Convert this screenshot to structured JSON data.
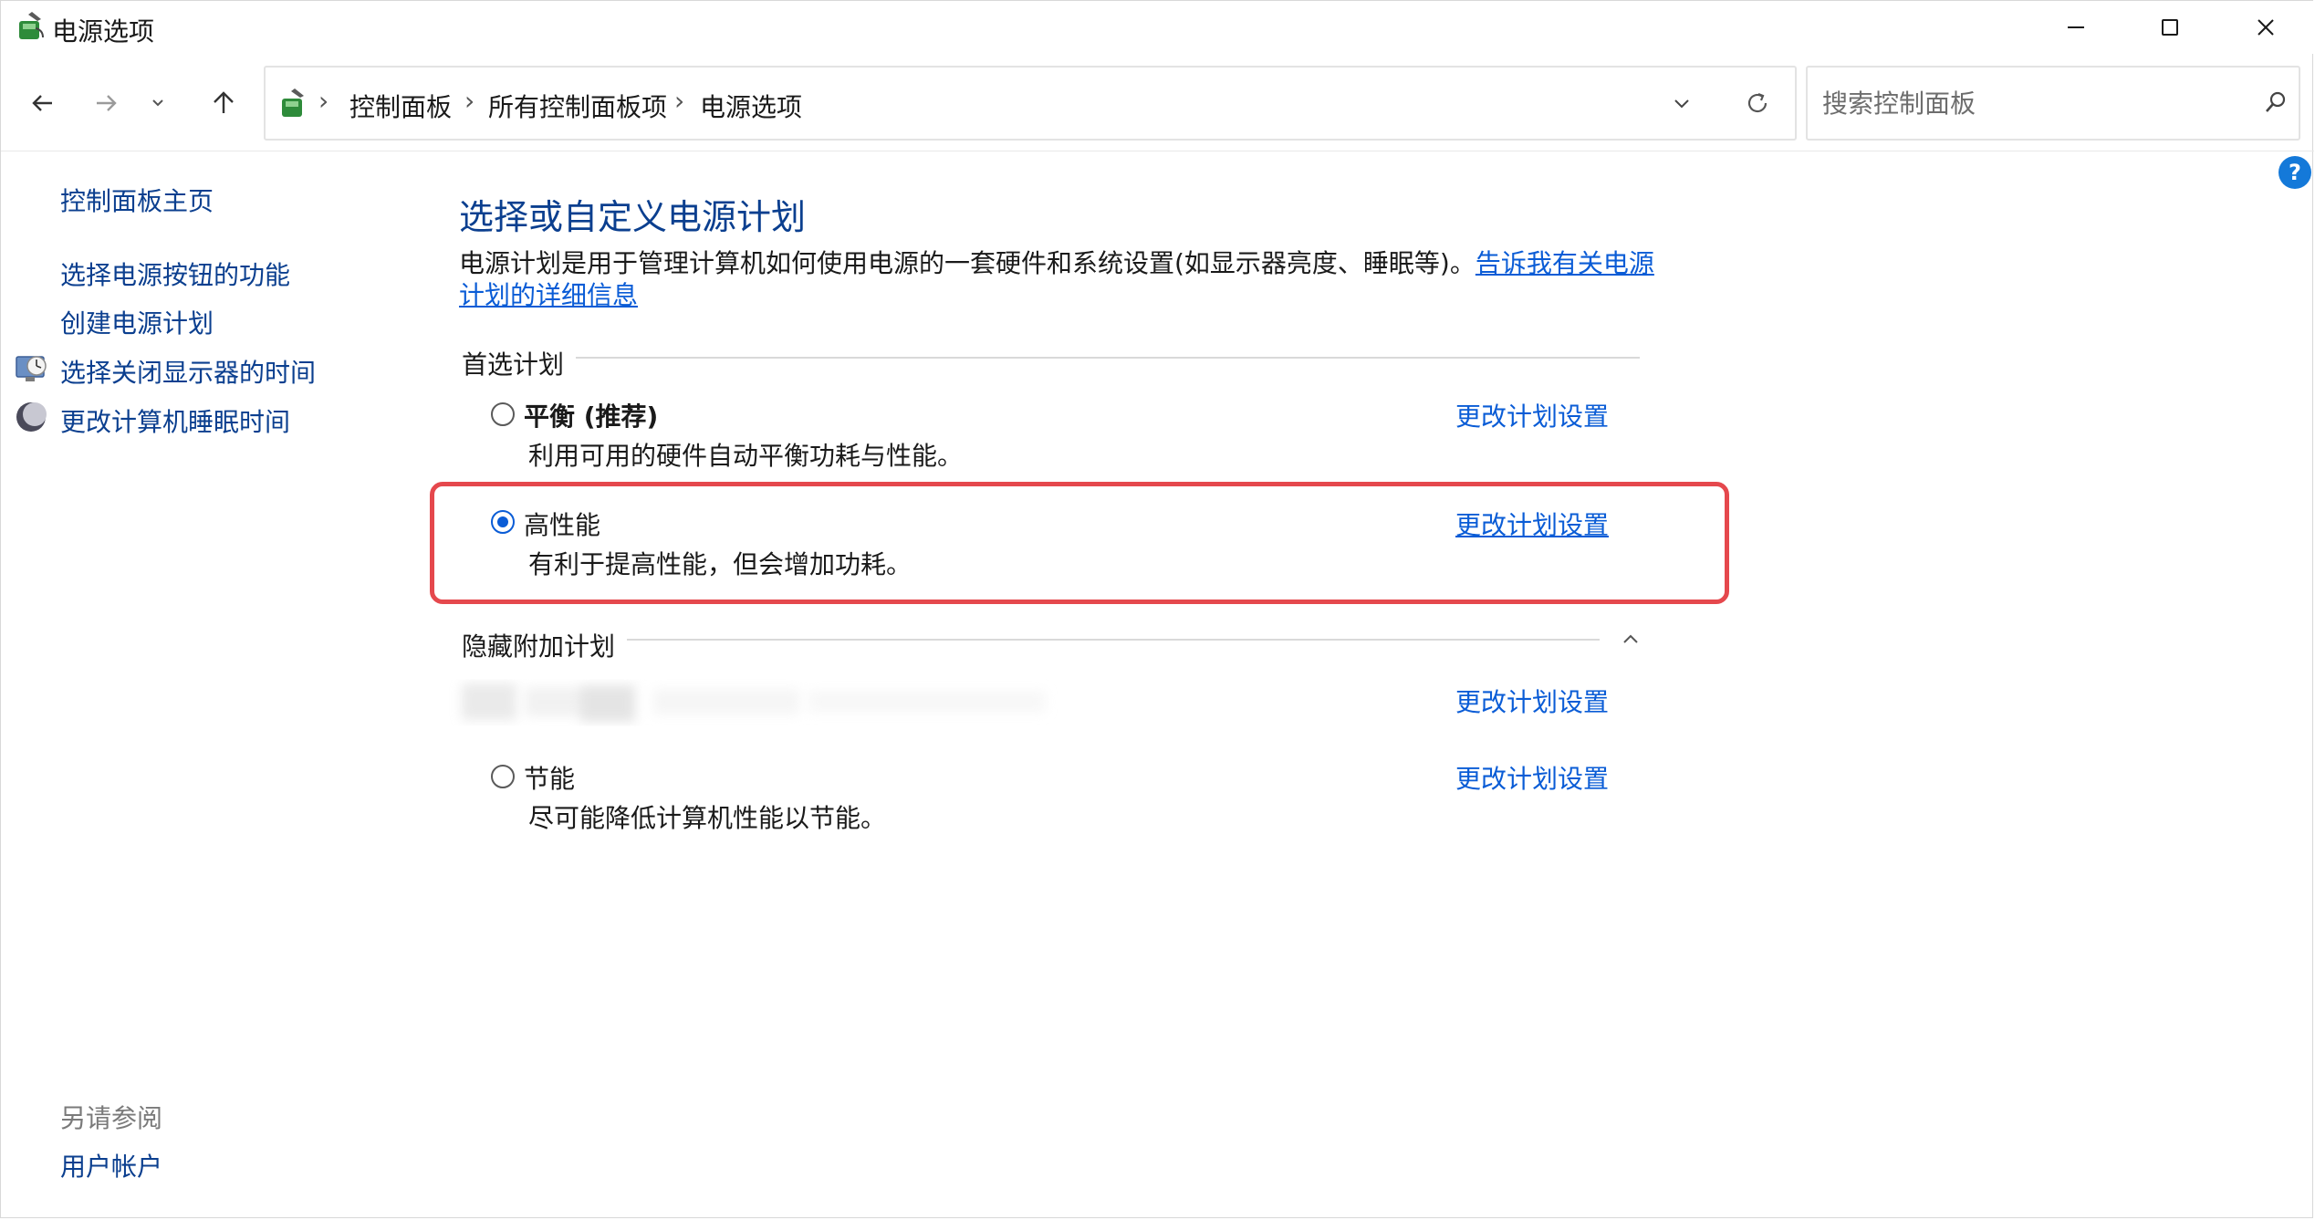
{
  "window": {
    "title": "电源选项"
  },
  "nav": {
    "breadcrumb": [
      "控制面板",
      "所有控制面板项",
      "电源选项"
    ],
    "search_placeholder": "搜索控制面板"
  },
  "sidebar": {
    "home": "控制面板主页",
    "items": [
      {
        "label": "选择电源按钮的功能",
        "icon": ""
      },
      {
        "label": "创建电源计划",
        "icon": ""
      },
      {
        "label": "选择关闭显示器的时间",
        "icon": "monitor-clock-icon"
      },
      {
        "label": "更改计算机睡眠时间",
        "icon": "moon-icon"
      }
    ],
    "see_also_label": "另请参阅",
    "see_also_items": [
      "用户帐户"
    ]
  },
  "main": {
    "heading": "选择或自定义电源计划",
    "description": "电源计划是用于管理计算机如何使用电源的一套硬件和系统设置(如显示器亮度、睡眠等)。",
    "description_link": "告诉我有关电源计划的详细信息",
    "preferred_label": "首选计划",
    "hidden_label": "隐藏附加计划",
    "plans": [
      {
        "name": "平衡 (推荐)",
        "desc": "利用可用的硬件自动平衡功耗与性能。",
        "link": "更改计划设置",
        "selected": false
      },
      {
        "name": "高性能",
        "desc": "有利于提高性能，但会增加功耗。",
        "link": "更改计划设置",
        "selected": true
      }
    ],
    "hidden_plans": [
      {
        "name": "",
        "desc": "",
        "link": "更改计划设置",
        "selected": false
      },
      {
        "name": "节能",
        "desc": "尽可能降低计算机性能以节能。",
        "link": "更改计划设置",
        "selected": false
      }
    ]
  },
  "colors": {
    "link": "#0a5cd6",
    "heading": "#0b3f8f",
    "highlight": "#e5484d",
    "help": "#1479d9"
  }
}
